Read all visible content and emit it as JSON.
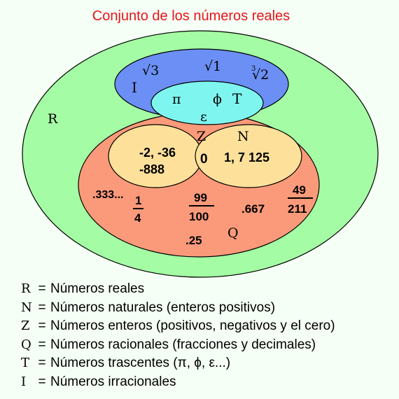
{
  "title": "Conjunto de los números reales",
  "colors": {
    "reals": "#a4fca4",
    "irrationals": "#6b8ff4",
    "transcendents": "#7ff5f0",
    "rationals": "#fb9a7a",
    "integers_naturals": "#fde19b",
    "title": "#e8141a"
  },
  "sets": {
    "R": "R",
    "I": "I",
    "T": "T",
    "Q": "Q",
    "Z": "Z",
    "N": "N"
  },
  "elements": {
    "sqrt3": "√3",
    "sqrt1": "√1",
    "cbrt2_index": "3",
    "cbrt2": "√2",
    "pi": "π",
    "phi": "ϕ",
    "epsilon": "ε",
    "neg_integers_1": "-2, -36",
    "neg_integers_2": "-888",
    "zero": "0",
    "naturals": "1, 7 125",
    "repeating": ".333...",
    "frac1_num": "1",
    "frac1_den": "4",
    "frac2_num": "99",
    "frac2_den": "100",
    "decimal_667": ".667",
    "frac3_num": "49",
    "frac3_den": "211",
    "decimal_25": ".25"
  },
  "legend": [
    {
      "symbol": "R",
      "eq": "=",
      "text": "Números reales"
    },
    {
      "symbol": "N",
      "eq": "=",
      "text": "Números naturales (enteros positivos)"
    },
    {
      "symbol": "Z",
      "eq": "=",
      "text": "Números enteros (positivos, negativos y el cero)"
    },
    {
      "symbol": "Q",
      "eq": "=",
      "text": "Números racionales (fracciones y decimales)"
    },
    {
      "symbol": "T",
      "eq": "=",
      "text": "Números trascentes (π, ϕ, ε...)"
    },
    {
      "symbol": "I",
      "eq": "=",
      "text": "Números irracionales"
    }
  ]
}
